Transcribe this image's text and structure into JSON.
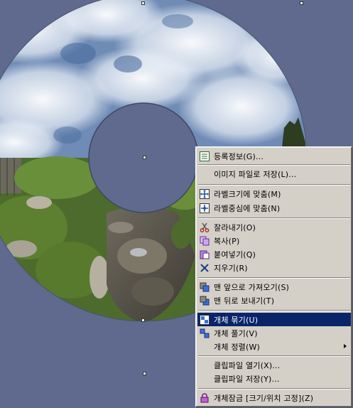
{
  "menu": {
    "items": [
      {
        "label": "등록정보(G)...",
        "icon": "properties-icon"
      },
      {
        "label": "이미지 파일로 저장(L)...",
        "icon": ""
      },
      {
        "label": "라벨크기에 맞춤(M)",
        "icon": "fit-size-icon"
      },
      {
        "label": "라벨중심에 맞춤(N)",
        "icon": "fit-center-icon"
      },
      {
        "label": "잘라내기(O)",
        "icon": "cut-icon"
      },
      {
        "label": "복사(P)",
        "icon": "copy-icon"
      },
      {
        "label": "붙여넣기(Q)",
        "icon": "paste-icon"
      },
      {
        "label": "지우기(R)",
        "icon": "delete-icon"
      },
      {
        "label": "맨 앞으로 가져오기(S)",
        "icon": "bring-to-front-icon"
      },
      {
        "label": "맨 뒤로 보내기(T)",
        "icon": "send-to-back-icon"
      },
      {
        "label": "개체 묶기(U)",
        "icon": "group-icon",
        "selected": true
      },
      {
        "label": "개체 풀기(V)",
        "icon": "ungroup-icon"
      },
      {
        "label": "개체 정렬(W)",
        "icon": "",
        "submenu": true
      },
      {
        "label": "클립파일 열기(X)...",
        "icon": ""
      },
      {
        "label": "클립파일 저장(Y)...",
        "icon": ""
      },
      {
        "label": "개체잠금 [크기/위치 고정](Z)",
        "icon": "lock-icon"
      }
    ]
  },
  "colors": {
    "background": "#5f6a8e",
    "menu_bg": "#d4d0c8",
    "highlight": "#0a246a"
  }
}
